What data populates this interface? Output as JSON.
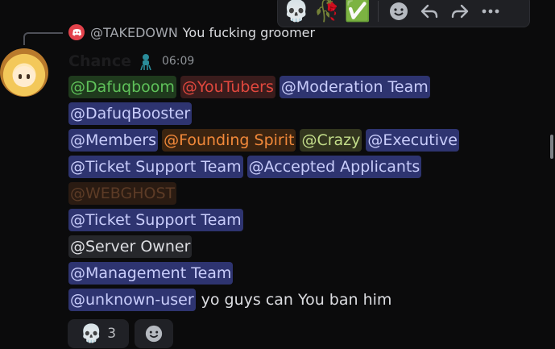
{
  "toolbar": {
    "items": [
      {
        "icon": "skull-icon",
        "glyph": "💀"
      },
      {
        "icon": "rose-icon",
        "glyph": "🥀"
      },
      {
        "icon": "check-mark-icon",
        "glyph": "✅"
      },
      {
        "icon": "add-reaction-icon"
      },
      {
        "icon": "reply-icon"
      },
      {
        "icon": "forward-icon"
      },
      {
        "icon": "more-icon"
      }
    ]
  },
  "reply": {
    "author": "@TAKEDOWN",
    "text": "You fucking groomer"
  },
  "message": {
    "author": "Chance",
    "timestamp": "06:09",
    "lines": [
      [
        {
          "text": "@Dafuqboom",
          "style": "green"
        },
        {
          "text": "@YouTubers",
          "style": "red"
        },
        {
          "text": "@Moderation Team",
          "style": "blue"
        }
      ],
      [
        {
          "text": "@DafuqBooster",
          "style": "blue"
        }
      ],
      [
        {
          "text": "@Members",
          "style": "blue"
        },
        {
          "text": "@Founding Spirit",
          "style": "orange"
        },
        {
          "text": "@Crazy",
          "style": "lime"
        },
        {
          "text": "@Executive",
          "style": "blue"
        }
      ],
      [
        {
          "text": "@Ticket  Support Team",
          "style": "blue"
        },
        {
          "text": "@Accepted Applicants",
          "style": "blue"
        }
      ],
      [
        {
          "text": "@WEBGHOST",
          "style": "ghost"
        }
      ],
      [
        {
          "text": "@Ticket  Support Team",
          "style": "blue"
        }
      ],
      [
        {
          "text": "@Server Owner",
          "style": "grey"
        }
      ],
      [
        {
          "text": "@Management Team",
          "style": "blue"
        }
      ],
      [
        {
          "text": "@unknown-user",
          "style": "blue"
        }
      ]
    ],
    "trailing_text": "yo guys can You ban him"
  },
  "reactions": {
    "skull_count": "3"
  },
  "colors": {
    "background": "#0b0b0c",
    "mention_blue_bg": "#2e3470",
    "mention_blue_fg": "#c9cdfb",
    "discord_red": "#e3424b"
  }
}
